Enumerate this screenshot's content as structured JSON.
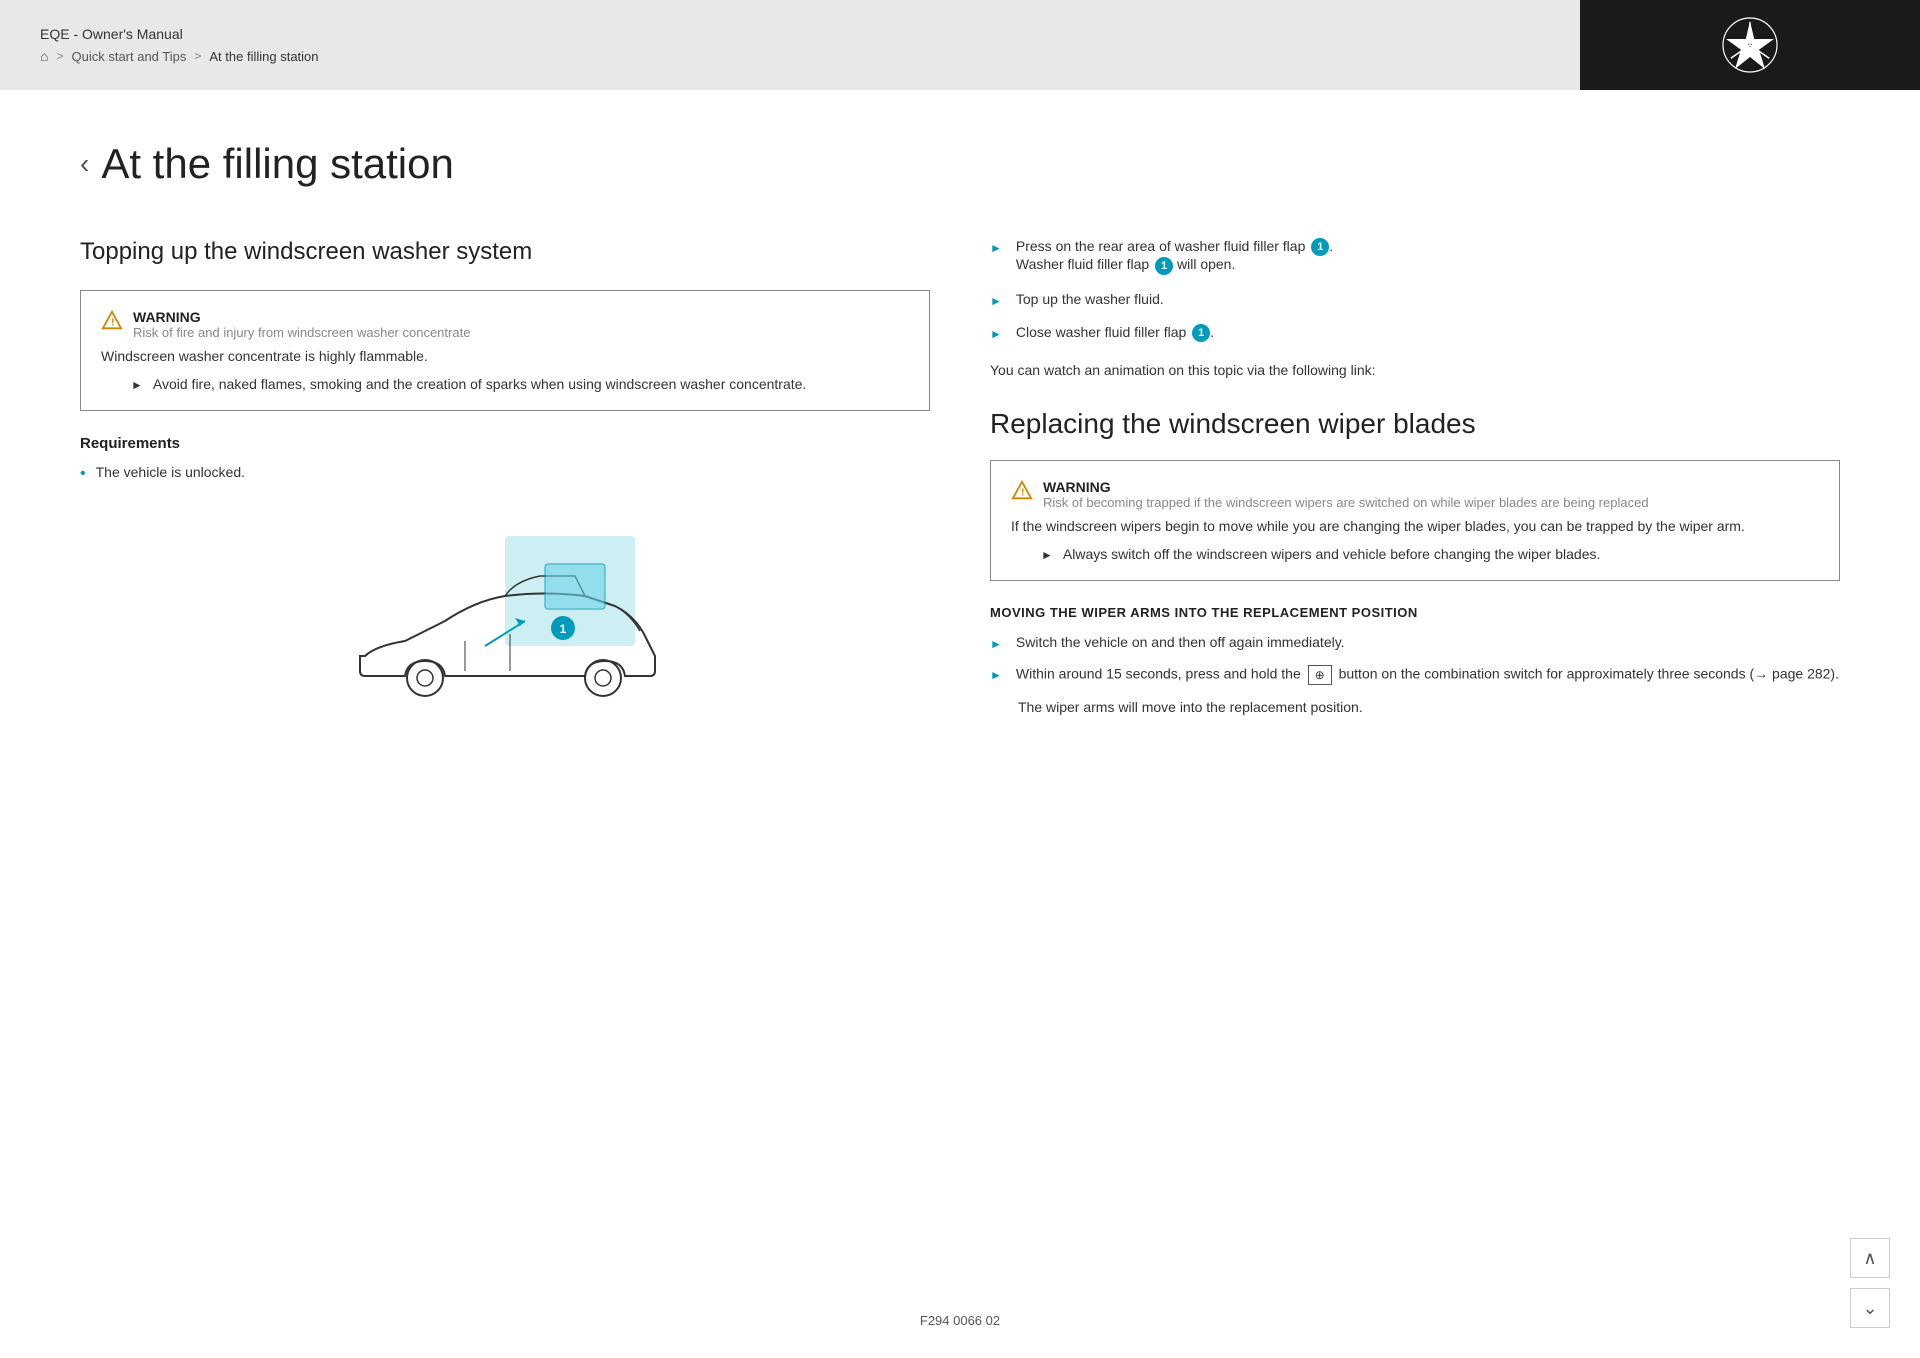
{
  "header": {
    "manual_title": "EQE - Owner's Manual",
    "breadcrumb": {
      "home_label": "⌂",
      "sep1": ">",
      "item1": "Quick start and Tips",
      "sep2": ">",
      "item2": "At the filling station"
    },
    "mercedes_logo_alt": "Mercedes-Benz star logo"
  },
  "page": {
    "back_chevron": "‹",
    "title": "At the filling station"
  },
  "left_column": {
    "section_title": "Topping up the windscreen washer system",
    "warning": {
      "label": "WARNING",
      "subtitle": "Risk of fire and injury from windscreen washer concentrate",
      "body": "Windscreen washer concentrate is highly flammable.",
      "bullet_arrow": "►",
      "bullet_text": "Avoid fire, naked flames, smoking and the creation of sparks when using windscreen washer concentrate."
    },
    "requirements_title": "Requirements",
    "requirements": [
      "The vehicle is unlocked."
    ]
  },
  "right_column": {
    "instructions": [
      {
        "arrow": "►",
        "text_before": "Press on the rear area of washer fluid filler flap",
        "circle_num": "1",
        "text_after": ".",
        "line2": "Washer fluid filler flap",
        "circle_num2": "1",
        "text_line2_after": " will open."
      },
      {
        "arrow": "►",
        "text": "Top up the washer fluid."
      },
      {
        "arrow": "►",
        "text_before": "Close washer fluid filler flap",
        "circle_num": "1",
        "text_after": "."
      }
    ],
    "animation_note": "You can watch an animation on this topic via the following link:",
    "section2_title": "Replacing the windscreen wiper blades",
    "warning2": {
      "label": "WARNING",
      "subtitle": "Risk of becoming trapped if the windscreen wipers are switched on while wiper blades are being replaced",
      "body": "If the windscreen wipers begin to move while you are changing the wiper blades, you can be trapped by the wiper arm.",
      "bullet_arrow": "►",
      "bullet_text": "Always switch off the windscreen wipers and vehicle before changing the wiper blades."
    },
    "moving_wiper_title": "MOVING THE WIPER ARMS INTO THE REPLACEMENT POSITION",
    "wiper_instructions": [
      {
        "arrow": "►",
        "text": "Switch the vehicle on and then off again immediately."
      },
      {
        "arrow": "►",
        "text_before": "Within around 15 seconds, press and hold the",
        "btn_icon": "⊕",
        "text_after": "button on the combination switch for approximately three seconds (→ page 282)."
      }
    ],
    "wiper_note": "The wiper arms will move into the replacement position."
  },
  "footer": {
    "code": "F294 0066 02"
  },
  "scroll_up": "∧",
  "scroll_down": "⌄"
}
